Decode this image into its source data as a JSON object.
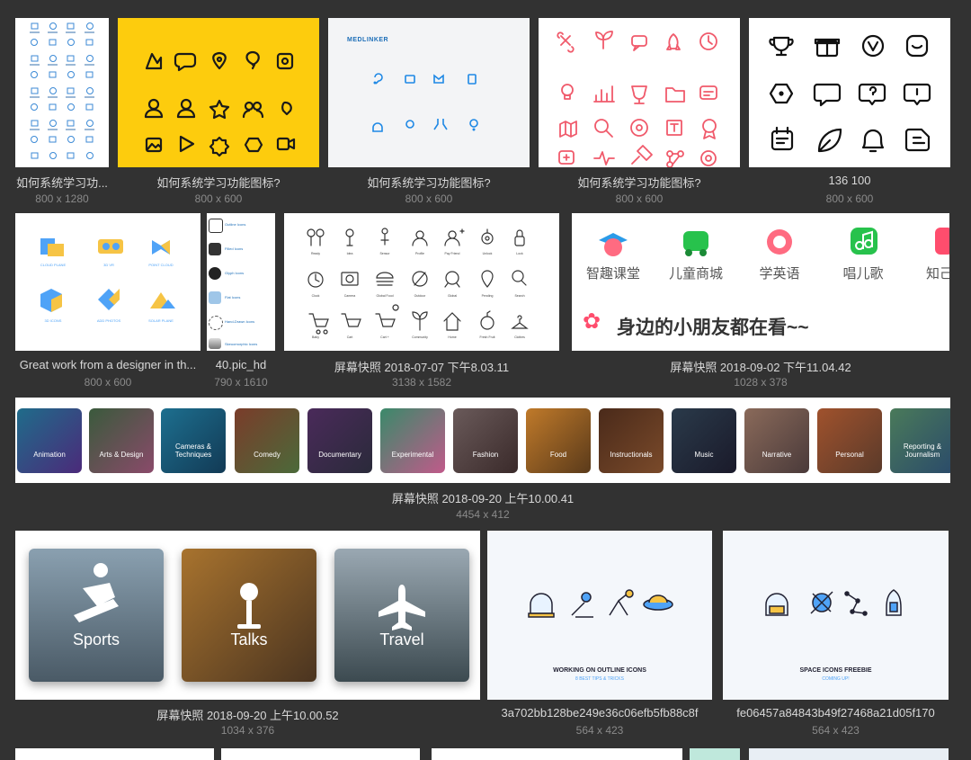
{
  "items": [
    {
      "caption": "如何系统学习功...",
      "size": "800 x 1280"
    },
    {
      "caption": "如何系统学习功能图标?",
      "size": "800 x 600"
    },
    {
      "caption": "如何系统学习功能图标?",
      "size": "800 x 600"
    },
    {
      "caption": "如何系统学习功能图标?",
      "size": "800 x 600"
    },
    {
      "caption": "136 100",
      "size": "800 x 600"
    },
    {
      "caption": "Great work from a designer in th...",
      "size": "800 x 600"
    },
    {
      "caption": "40.pic_hd",
      "size": "790 x 1610"
    },
    {
      "caption": "屏幕快照 2018-07-07 下午8.03.11",
      "size": "3138 x 1582"
    },
    {
      "caption": "屏幕快照 2018-09-02 下午11.04.42",
      "size": "1028 x 378"
    },
    {
      "caption": "屏幕快照 2018-09-20 上午10.00.41",
      "size": "4454 x 412"
    },
    {
      "caption": "屏幕快照 2018-09-20 上午10.00.52",
      "size": "1034 x 376"
    },
    {
      "caption": "3a702bb128be249e36c06efb5fb88c8f",
      "size": "564 x 423"
    },
    {
      "caption": "fe06457a84843b49f27468a21d05f170",
      "size": "564 x 423"
    }
  ],
  "thumbs": {
    "medlinker": "MEDLINKER",
    "kids": {
      "labels": [
        "智趣课堂",
        "儿童商城",
        "学英语",
        "唱儿歌",
        "知己"
      ],
      "banner": "身边的小朋友都在看~~"
    },
    "pastel": [
      "CLOUD PLANE",
      "3D VR",
      "POINT CLOUD",
      "3D ICONS",
      "ADD PHOTOS",
      "SOLAR PLANE"
    ],
    "styles": [
      "Outline Icons",
      "Filled Icons",
      "Glyph Icons",
      "Flat Icons",
      "Hand-Drawn Icons",
      "Skeuomorphic Icons"
    ],
    "hand_icons": [
      "Ready",
      "Idea",
      "Sensor",
      "Profile",
      "Pay Friend",
      "Unlock",
      "Lock",
      "Clock",
      "Camera",
      "Global Food",
      "Outdoor",
      "Global",
      "Pending",
      "Search",
      "Baby",
      "Cart",
      "Cart +",
      "Community",
      "Home",
      "Fresh Fruit",
      "Clothes"
    ],
    "categories": [
      "Animation",
      "Arts & Design",
      "Cameras & Techniques",
      "Comedy",
      "Documentary",
      "Experimental",
      "Fashion",
      "Food",
      "Instructionals",
      "Music",
      "Narrative",
      "Personal",
      "Reporting & Journalism"
    ],
    "cards": [
      "Sports",
      "Talks",
      "Travel"
    ],
    "outline": {
      "title": "WORKING ON OUTLINE ICONS",
      "sub": "8 BEST TIPS & TRICKS"
    },
    "space": {
      "title": "SPACE ICONS FREEBIE",
      "sub": "COMING UP!"
    }
  },
  "colors": {
    "background": "#323232",
    "yellow": "#fdcc0d",
    "red_icon": "#f05a6b",
    "blue_icon": "#1e88e5"
  }
}
